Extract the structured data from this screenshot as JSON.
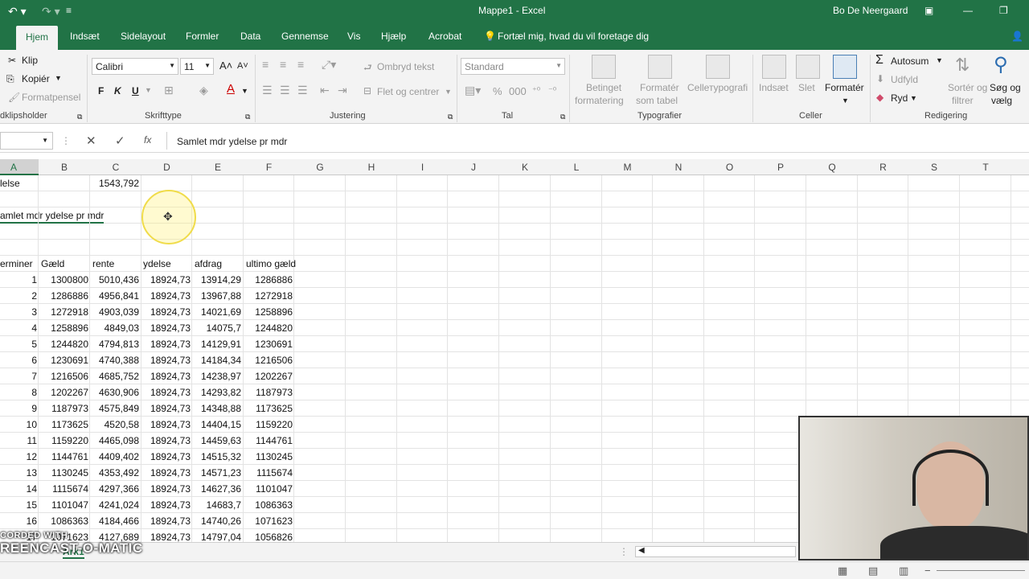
{
  "titlebar": {
    "title": "Mappe1 - Excel",
    "user": "Bo De Neergaard"
  },
  "tabs": [
    "Hjem",
    "Indsæt",
    "Sidelayout",
    "Formler",
    "Data",
    "Gennemse",
    "Vis",
    "Hjælp",
    "Acrobat"
  ],
  "tellme": "Fortæl mig, hvad du vil foretage dig",
  "clipboard": {
    "cut": "Klip",
    "copy": "Kopiér",
    "format": "Formatpensel",
    "label": "dklipsholder"
  },
  "font": {
    "name": "Calibri",
    "size": "11",
    "bold": "F",
    "italic": "K",
    "underline": "U",
    "label": "Skrifttype"
  },
  "alignment": {
    "wrap": "Ombryd tekst",
    "merge": "Flet og centrer",
    "label": "Justering"
  },
  "number": {
    "format": "Standard",
    "label": "Tal"
  },
  "styles": {
    "cond": "Betinget",
    "cond2": "formatering",
    "table": "Formatér",
    "table2": "som tabel",
    "cell": "Cellетypografi",
    "label": "Typografier"
  },
  "cells": {
    "insert": "Indsæt",
    "delete": "Slet",
    "format": "Formatér",
    "label": "Celler"
  },
  "editing": {
    "autosum": "Autosum",
    "fill": "Udfyld",
    "clear": "Ryd",
    "sort": "Sortér og",
    "sort2": "filtrer",
    "find": "Søg og",
    "find2": "vælg",
    "label": "Redigering"
  },
  "formula_bar": {
    "fx": "fx",
    "content": "Samlet mdr ydelse pr mdr"
  },
  "columns": [
    "A",
    "B",
    "C",
    "D",
    "E",
    "F",
    "G",
    "H",
    "I",
    "J",
    "K",
    "L",
    "M",
    "N",
    "O",
    "P",
    "Q",
    "R",
    "S",
    "T"
  ],
  "sheet": {
    "r1a": "lelse",
    "r1c": "1543,792",
    "r3a": "amlet mdr ydelse pr mdr",
    "headers": [
      "erminer",
      "Gæld",
      "rente",
      "ydelse",
      "afdrag",
      "ultimo gæld"
    ],
    "rows": [
      [
        "1",
        "1300800",
        "5010,436",
        "18924,73",
        "13914,29",
        "1286886"
      ],
      [
        "2",
        "1286886",
        "4956,841",
        "18924,73",
        "13967,88",
        "1272918"
      ],
      [
        "3",
        "1272918",
        "4903,039",
        "18924,73",
        "14021,69",
        "1258896"
      ],
      [
        "4",
        "1258896",
        "4849,03",
        "18924,73",
        "14075,7",
        "1244820"
      ],
      [
        "5",
        "1244820",
        "4794,813",
        "18924,73",
        "14129,91",
        "1230691"
      ],
      [
        "6",
        "1230691",
        "4740,388",
        "18924,73",
        "14184,34",
        "1216506"
      ],
      [
        "7",
        "1216506",
        "4685,752",
        "18924,73",
        "14238,97",
        "1202267"
      ],
      [
        "8",
        "1202267",
        "4630,906",
        "18924,73",
        "14293,82",
        "1187973"
      ],
      [
        "9",
        "1187973",
        "4575,849",
        "18924,73",
        "14348,88",
        "1173625"
      ],
      [
        "10",
        "1173625",
        "4520,58",
        "18924,73",
        "14404,15",
        "1159220"
      ],
      [
        "11",
        "1159220",
        "4465,098",
        "18924,73",
        "14459,63",
        "1144761"
      ],
      [
        "12",
        "1144761",
        "4409,402",
        "18924,73",
        "14515,32",
        "1130245"
      ],
      [
        "13",
        "1130245",
        "4353,492",
        "18924,73",
        "14571,23",
        "1115674"
      ],
      [
        "14",
        "1115674",
        "4297,366",
        "18924,73",
        "14627,36",
        "1101047"
      ],
      [
        "15",
        "1101047",
        "4241,024",
        "18924,73",
        "14683,7",
        "1086363"
      ],
      [
        "16",
        "1086363",
        "4184,466",
        "18924,73",
        "14740,26",
        "1071623"
      ],
      [
        "17",
        "1071623",
        "4127,689",
        "18924,73",
        "14797,04",
        "1056826"
      ]
    ]
  },
  "sheet_tab": "Ark1",
  "watermark": {
    "line1": "CORDED WITH",
    "line2": "REENCAST-O-MATIC"
  }
}
